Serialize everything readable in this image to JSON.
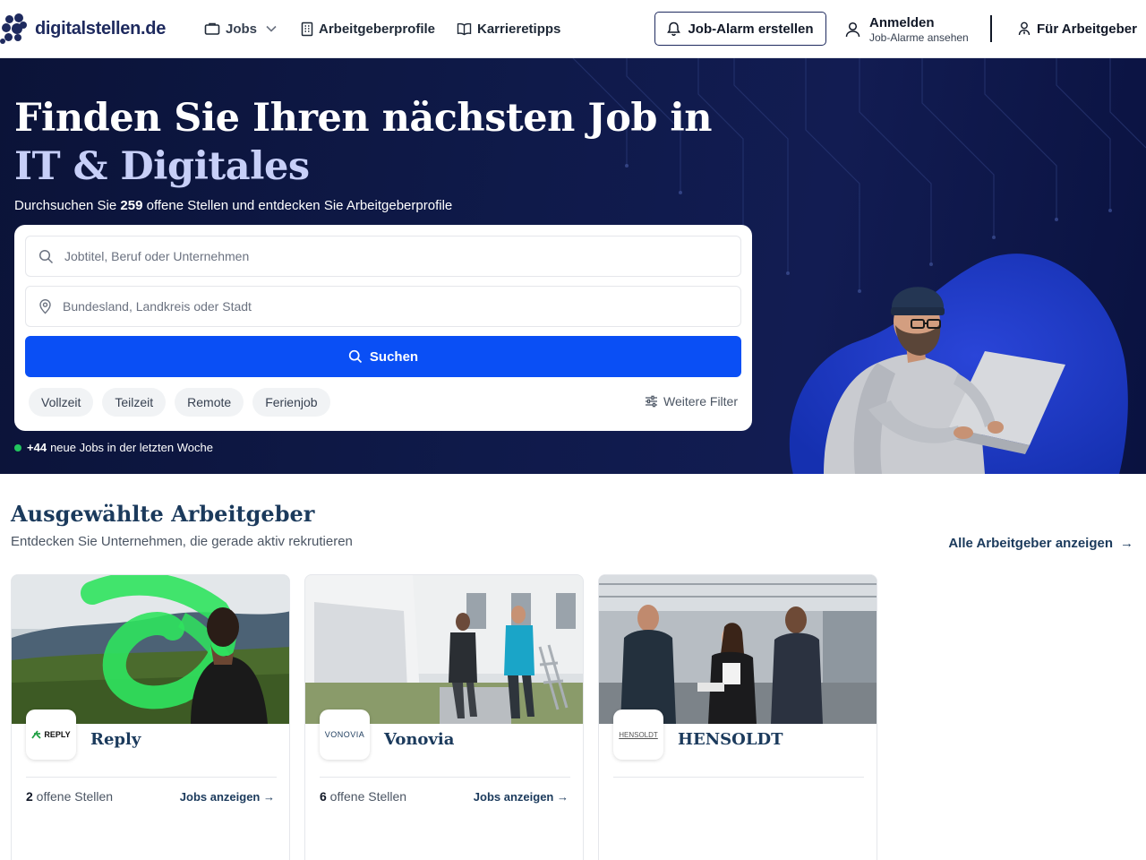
{
  "header": {
    "logo_text": "digitalstellen.de",
    "nav": {
      "jobs": "Jobs",
      "profiles": "Arbeitgeberprofile",
      "tips": "Karrieretipps"
    },
    "alarm_button": "Job-Alarm erstellen",
    "login_title": "Anmelden",
    "login_subtitle": "Job-Alarme ansehen",
    "employer_link": "Für Arbeitgeber"
  },
  "hero": {
    "title_line1": "Finden Sie Ihren nächsten Job in",
    "title_line2": "IT & Digitales",
    "subtitle_pre": "Durchsuchen Sie ",
    "subtitle_count": "259",
    "subtitle_post": " offene Stellen und entdecken Sie Arbeitgeberprofile",
    "search": {
      "job_placeholder": "Jobtitel, Beruf oder Unternehmen",
      "location_placeholder": "Bundesland, Landkreis oder Stadt",
      "button": "Suchen"
    },
    "chips": [
      "Vollzeit",
      "Teilzeit",
      "Remote",
      "Ferienjob"
    ],
    "more_filters": "Weitere Filter",
    "new_jobs_count": "+44",
    "new_jobs_text": "neue Jobs in der letzten Woche"
  },
  "employers": {
    "title": "Ausgewählte Arbeitgeber",
    "subtitle": "Entdecken Sie Unternehmen, die gerade aktiv rekrutieren",
    "all_link": "Alle Arbeitgeber anzeigen",
    "all_link_arrow": "→",
    "cards": [
      {
        "name": "Reply",
        "logo_text": "REPLY",
        "count": "2",
        "count_label": " offene Stellen",
        "link": "Jobs anzeigen",
        "link_arrow": "→"
      },
      {
        "name": "Vonovia",
        "logo_text": "VONOVIA",
        "count": "6",
        "count_label": " offene Stellen",
        "link": "Jobs anzeigen",
        "link_arrow": "→"
      },
      {
        "name": "HENSOLDT",
        "logo_text": "HENSOLDT",
        "count": "",
        "count_label": "",
        "link": "",
        "link_arrow": ""
      }
    ]
  },
  "colors": {
    "hero_bg": "#0f1a4a",
    "primary_button": "#0a4ff5",
    "heading": "#1b3a5c",
    "new_jobs_dot": "#22c55e"
  }
}
